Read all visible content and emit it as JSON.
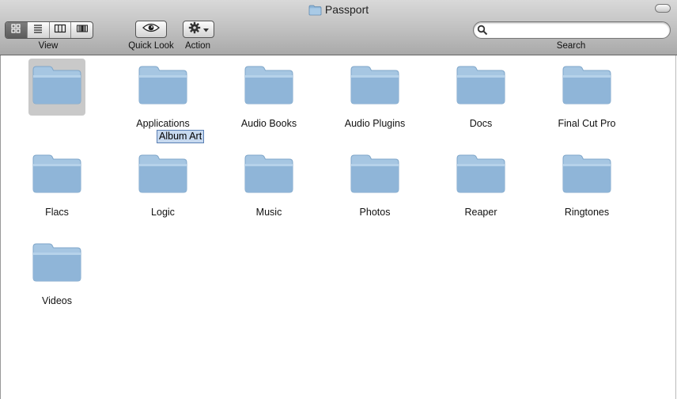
{
  "window": {
    "title": "Passport"
  },
  "toolbar": {
    "view_label": "View",
    "view_modes": [
      "icon-view-icon",
      "list-view-icon",
      "column-view-icon",
      "cover-flow-icon"
    ],
    "active_view": 0,
    "quicklook_label": "Quick Look",
    "action_label": "Action",
    "search_label": "Search",
    "search_value": "",
    "search_placeholder": ""
  },
  "rename": {
    "value": "Album Art"
  },
  "items": [
    {
      "label": "",
      "selected": true
    },
    {
      "label": "Applications"
    },
    {
      "label": "Audio Books"
    },
    {
      "label": "Audio Plugins"
    },
    {
      "label": "Docs"
    },
    {
      "label": "Final Cut Pro"
    },
    {
      "label": "Flacs"
    },
    {
      "label": "Logic"
    },
    {
      "label": "Music"
    },
    {
      "label": "Photos"
    },
    {
      "label": "Reaper"
    },
    {
      "label": "Ringtones"
    },
    {
      "label": "Videos"
    }
  ],
  "colors": {
    "folder_top": "#b8d3e8",
    "folder_body": "#9fc1dd",
    "selection_gray": "#c9c9c9",
    "rename_highlight": "#c7d9ef"
  }
}
